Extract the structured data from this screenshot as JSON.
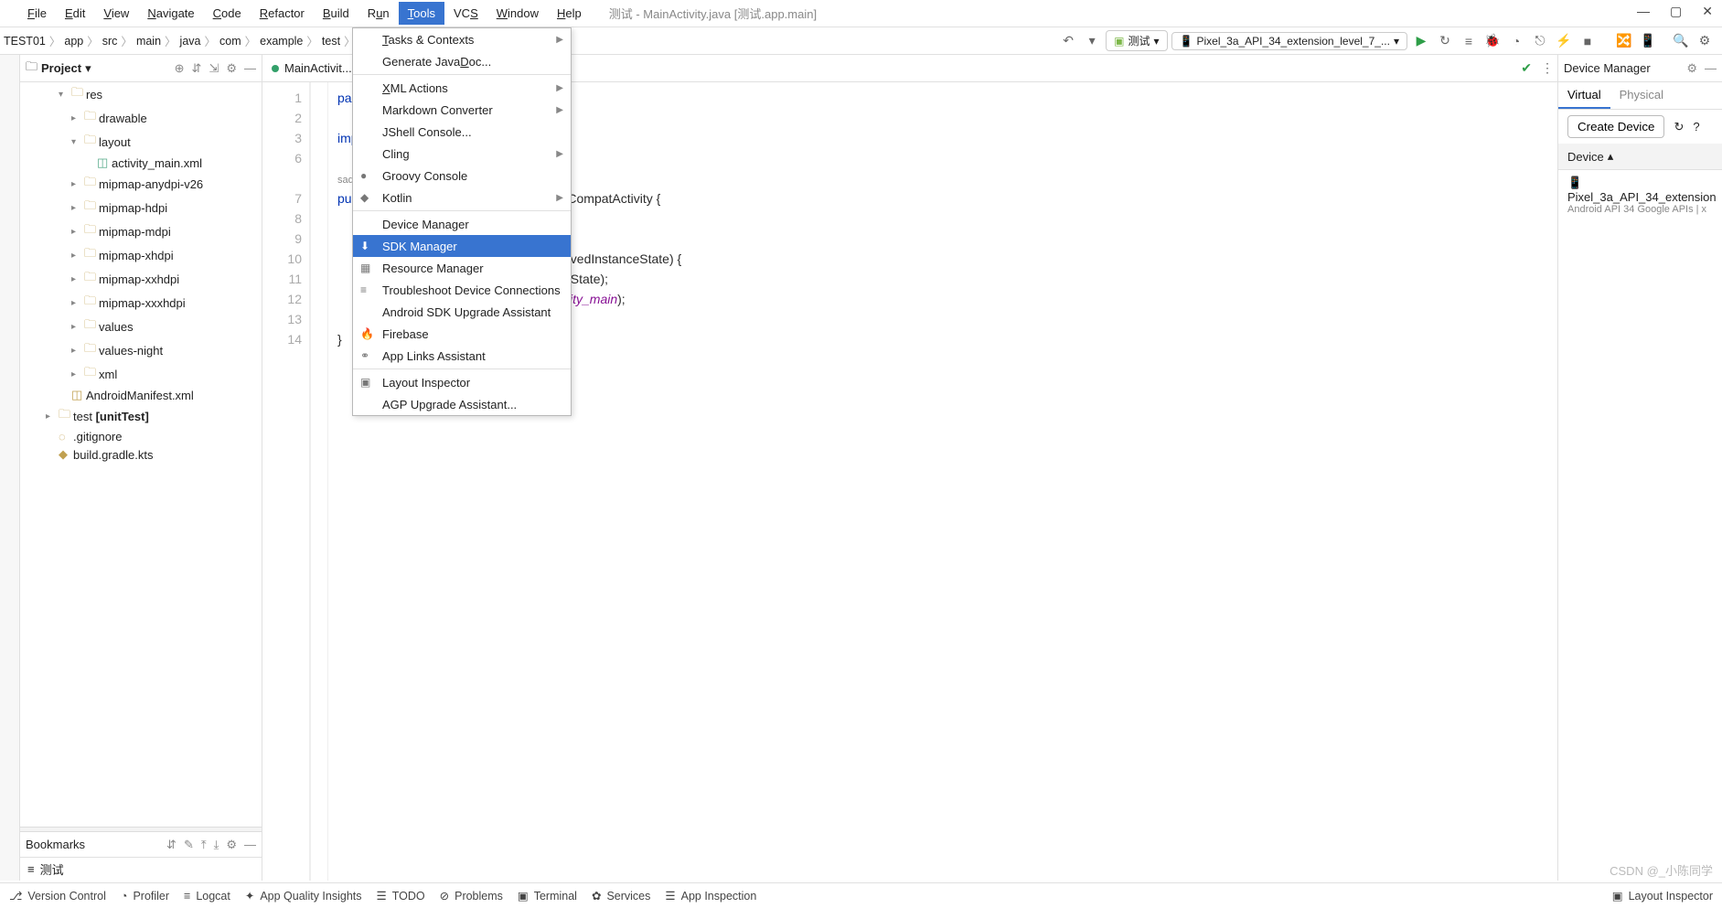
{
  "window": {
    "title": "测试 - MainActivity.java [测试.app.main]"
  },
  "menubar": [
    "File",
    "Edit",
    "View",
    "Navigate",
    "Code",
    "Refactor",
    "Build",
    "Run",
    "Tools",
    "VCS",
    "Window",
    "Help"
  ],
  "active_menu": "Tools",
  "breadcrumb": [
    "TEST01",
    "app",
    "src",
    "main",
    "java",
    "com",
    "example",
    "test"
  ],
  "run_config": {
    "app_label": "测试",
    "device_label": "Pixel_3a_API_34_extension_level_7_..."
  },
  "project": {
    "title": "Project",
    "tree": [
      {
        "indent": 3,
        "arrow": "▾",
        "icon": "📁",
        "label": "res"
      },
      {
        "indent": 4,
        "arrow": "▸",
        "icon": "📁",
        "label": "drawable"
      },
      {
        "indent": 4,
        "arrow": "▾",
        "icon": "📁",
        "label": "layout"
      },
      {
        "indent": 5,
        "arrow": "",
        "icon": "xml",
        "label": "activity_main.xml"
      },
      {
        "indent": 4,
        "arrow": "▸",
        "icon": "📁",
        "label": "mipmap-anydpi-v26"
      },
      {
        "indent": 4,
        "arrow": "▸",
        "icon": "📁",
        "label": "mipmap-hdpi"
      },
      {
        "indent": 4,
        "arrow": "▸",
        "icon": "📁",
        "label": "mipmap-mdpi"
      },
      {
        "indent": 4,
        "arrow": "▸",
        "icon": "📁",
        "label": "mipmap-xhdpi"
      },
      {
        "indent": 4,
        "arrow": "▸",
        "icon": "📁",
        "label": "mipmap-xxhdpi"
      },
      {
        "indent": 4,
        "arrow": "▸",
        "icon": "📁",
        "label": "mipmap-xxxhdpi"
      },
      {
        "indent": 4,
        "arrow": "▸",
        "icon": "📁",
        "label": "values"
      },
      {
        "indent": 4,
        "arrow": "▸",
        "icon": "📁",
        "label": "values-night"
      },
      {
        "indent": 4,
        "arrow": "▸",
        "icon": "📁",
        "label": "xml"
      },
      {
        "indent": 3,
        "arrow": "",
        "icon": "mf",
        "label": "AndroidManifest.xml"
      },
      {
        "indent": 2,
        "arrow": "▸",
        "icon": "📁",
        "label": "test [unitTest]",
        "bold": "test "
      },
      {
        "indent": 2,
        "arrow": "",
        "icon": "gi",
        "label": ".gitignore"
      },
      {
        "indent": 2,
        "arrow": "",
        "icon": "gr",
        "label": "build.gradle.kts"
      }
    ]
  },
  "bookmarks": {
    "title": "Bookmarks",
    "items": [
      "测试"
    ]
  },
  "editor": {
    "tab": "MainActivit...",
    "gutter": [
      "1",
      "2",
      "3",
      "6",
      "",
      "7",
      "8",
      "9",
      "10",
      "11",
      "12",
      "13",
      "14"
    ],
    "code_fragments": {
      "l1": "pack",
      "l3": "impo",
      "l5_pre": "sad",
      "l6": "publ",
      "l6_rest": "AppCompatActivity {",
      "l10_a": " savedInstanceState) {",
      "l11_a": "ceState);",
      "l12_a": "tivity_main",
      "l12_b": ");",
      "l14": "}"
    }
  },
  "tools_menu": [
    {
      "label": "Tasks & Contexts",
      "sub": true,
      "u": "T"
    },
    {
      "label": "Generate JavaDoc...",
      "u": "D"
    },
    {
      "sep": true
    },
    {
      "label": "XML Actions",
      "sub": true,
      "u": "X"
    },
    {
      "label": "Markdown Converter",
      "sub": true
    },
    {
      "label": "JShell Console..."
    },
    {
      "label": "Cling",
      "sub": true
    },
    {
      "label": "Groovy Console",
      "icon": "●"
    },
    {
      "label": "Kotlin",
      "sub": true,
      "icon": "◆"
    },
    {
      "sep": true
    },
    {
      "label": "Device Manager"
    },
    {
      "label": "SDK Manager",
      "selected": true,
      "icon": "⬇"
    },
    {
      "label": "Resource Manager",
      "icon": "▦"
    },
    {
      "label": "Troubleshoot Device Connections",
      "icon": "≡"
    },
    {
      "label": "Android SDK Upgrade Assistant"
    },
    {
      "label": "Firebase",
      "icon": "🔥"
    },
    {
      "label": "App Links Assistant",
      "icon": "⚭"
    },
    {
      "sep": true
    },
    {
      "label": "Layout Inspector",
      "icon": "▣"
    },
    {
      "label": "AGP Upgrade Assistant..."
    }
  ],
  "device_manager": {
    "title": "Device Manager",
    "tabs": [
      "Virtual",
      "Physical"
    ],
    "active_tab": "Virtual",
    "create": "Create Device",
    "column": "Device",
    "device_name": "Pixel_3a_API_34_extension",
    "device_sub": "Android API 34 Google APIs | x"
  },
  "statusbar": {
    "items": [
      "Version Control",
      "Profiler",
      "Logcat",
      "App Quality Insights",
      "TODO",
      "Problems",
      "Terminal",
      "Services",
      "App Inspection"
    ],
    "right": "Layout Inspector"
  },
  "watermark": "CSDN @_小陈同学"
}
